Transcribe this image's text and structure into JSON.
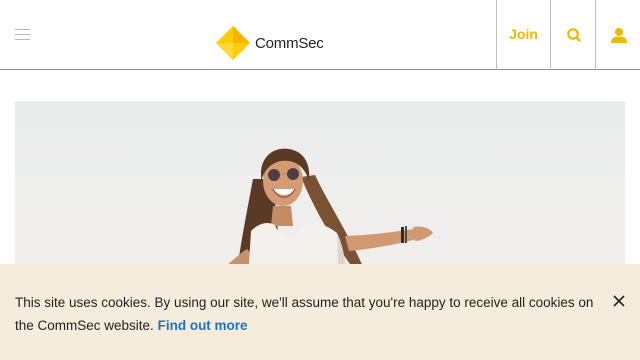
{
  "header": {
    "brand": "CommSec",
    "join_label": "Join",
    "menu_icon": "hamburger-menu-icon",
    "search_icon": "search-icon",
    "account_icon": "user-icon",
    "accent_color": "#f0b800"
  },
  "hero": {
    "image": "woman-laughing-with-outstretched-arms-photo"
  },
  "cookie_banner": {
    "message": "This site uses cookies. By using our site, we'll assume that you're happy to receive all cookies on the CommSec website.",
    "link_label": "Find out more",
    "close_icon": "close-icon",
    "background": "#f5ecdb",
    "link_color": "#1a74c2"
  }
}
